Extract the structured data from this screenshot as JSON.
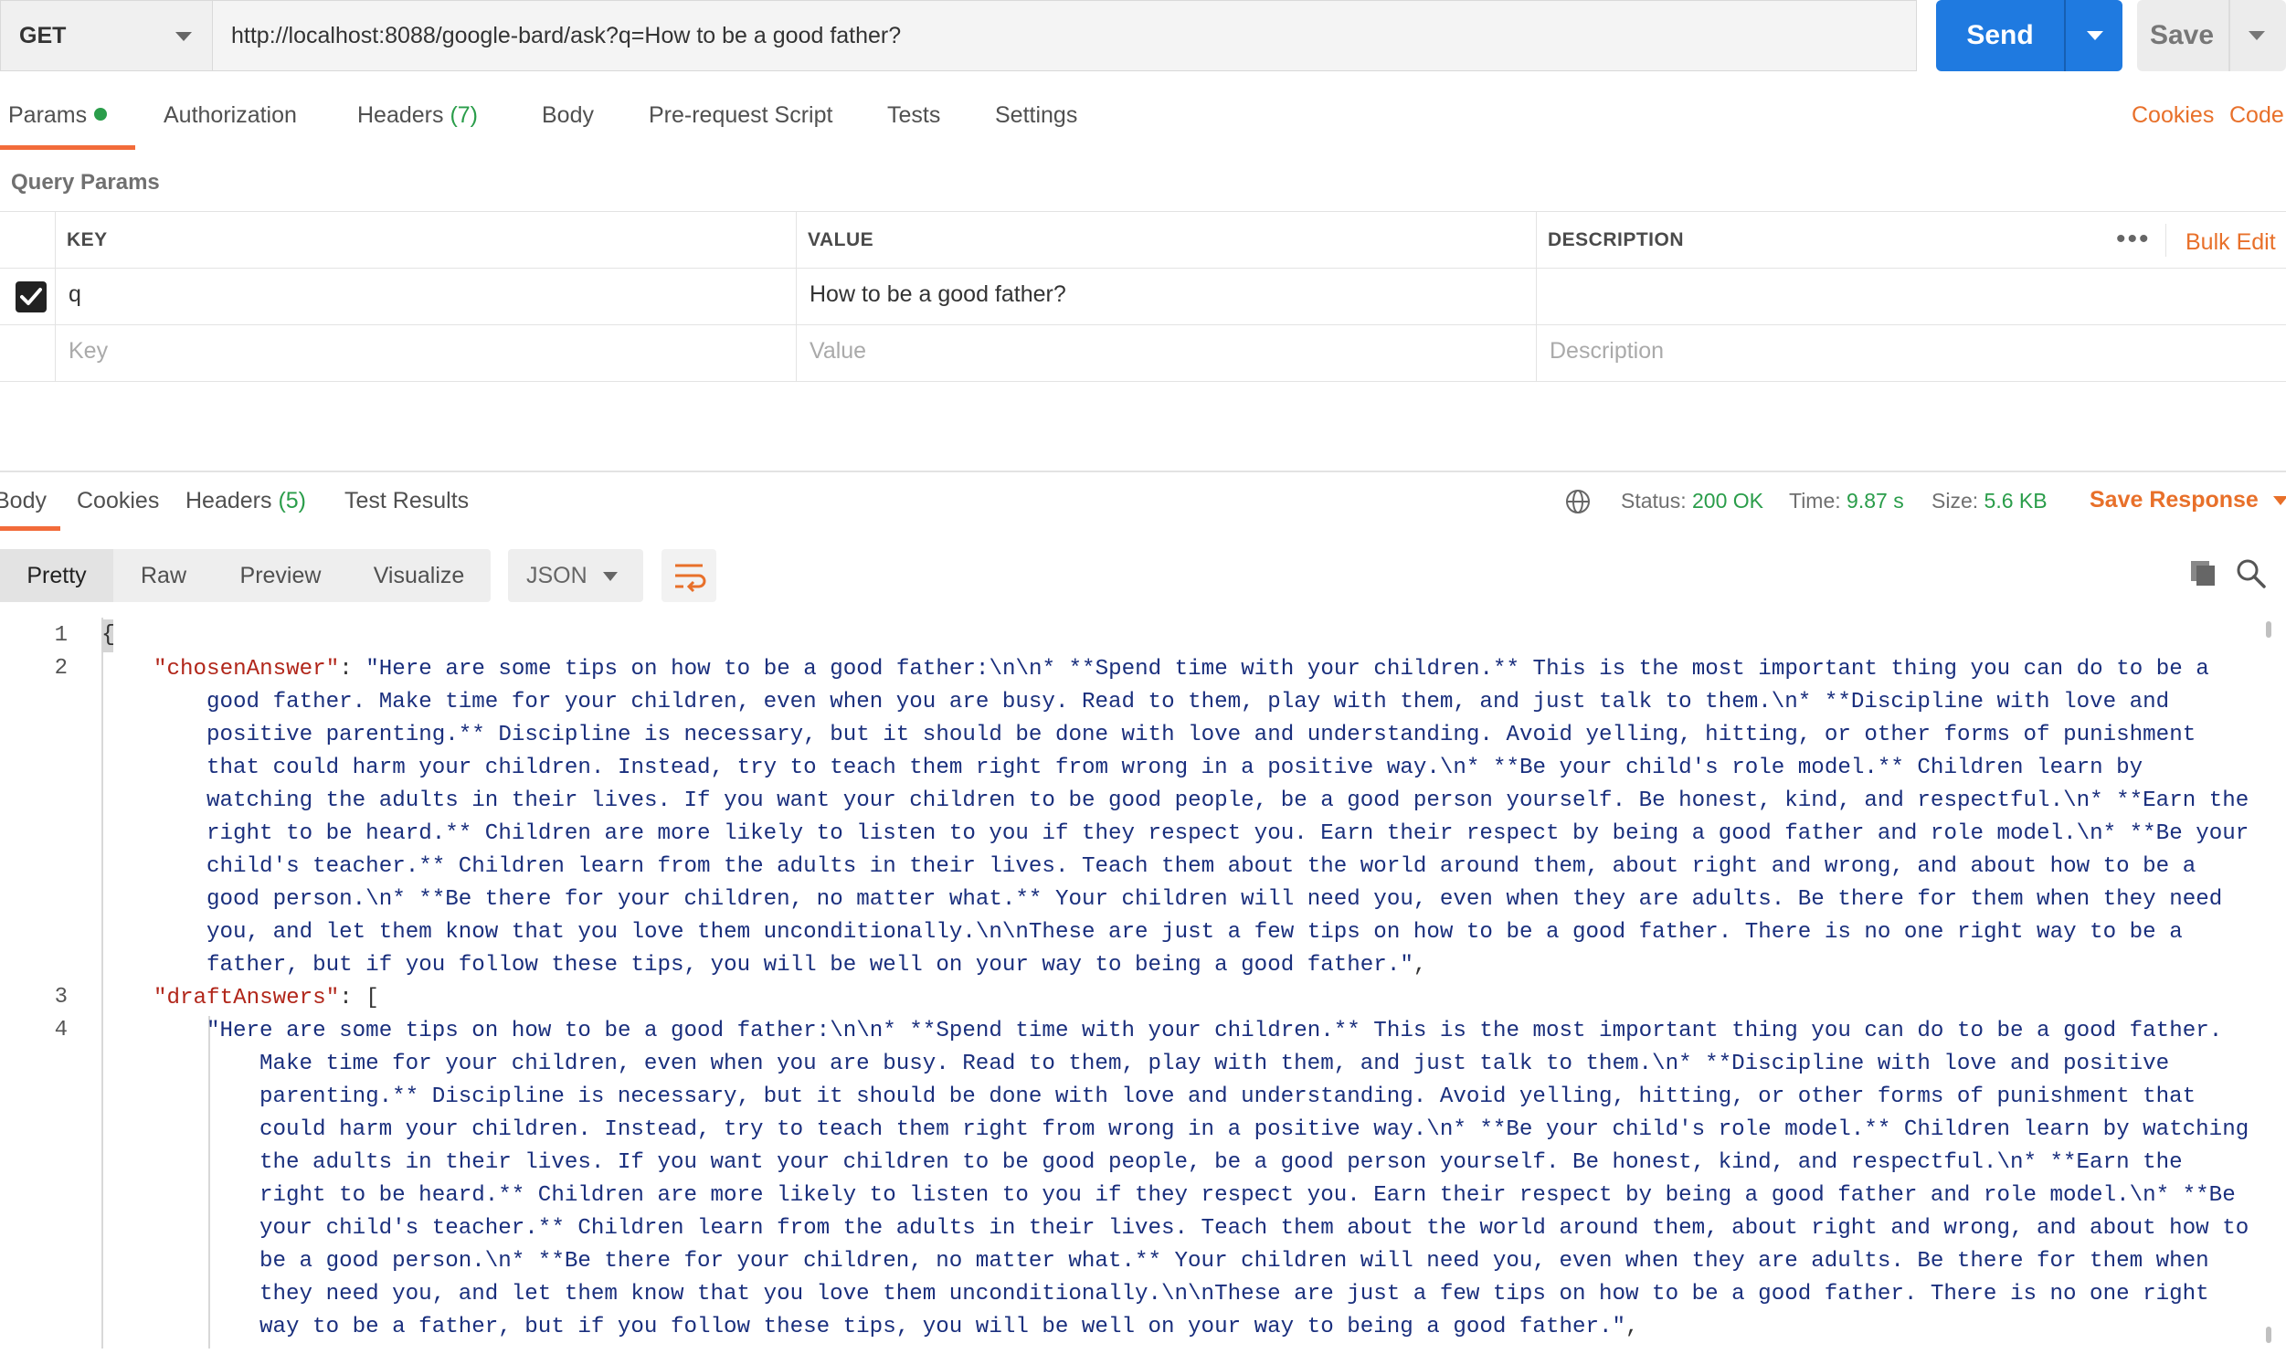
{
  "request": {
    "method": "GET",
    "url": "http://localhost:8088/google-bard/ask?q=How to be a good father?",
    "send_label": "Send",
    "save_label": "Save"
  },
  "request_tabs": [
    {
      "label": "Params",
      "active": true
    },
    {
      "label": "Authorization"
    },
    {
      "label": "Headers",
      "count": "(7)"
    },
    {
      "label": "Body"
    },
    {
      "label": "Pre-request Script"
    },
    {
      "label": "Tests"
    },
    {
      "label": "Settings"
    }
  ],
  "right_links": {
    "cookies": "Cookies",
    "code": "Code"
  },
  "query_params": {
    "section_label": "Query Params",
    "headers": {
      "key": "KEY",
      "value": "VALUE",
      "description": "DESCRIPTION"
    },
    "bulk_edit": "Bulk Edit",
    "more": "•••",
    "rows": [
      {
        "checked": true,
        "key": "q",
        "value": "How to be a good father?",
        "description": ""
      }
    ],
    "placeholders": {
      "key": "Key",
      "value": "Value",
      "description": "Description"
    }
  },
  "response_tabs": [
    {
      "label": "Body",
      "active": true
    },
    {
      "label": "Cookies"
    },
    {
      "label": "Headers",
      "count": "(5)"
    },
    {
      "label": "Test Results"
    }
  ],
  "response_meta": {
    "status_label": "Status:",
    "status": "200 OK",
    "time_label": "Time:",
    "time": "9.87 s",
    "size_label": "Size:",
    "size": "5.6 KB",
    "save_response": "Save Response"
  },
  "view_modes": [
    "Pretty",
    "Raw",
    "Preview",
    "Visualize"
  ],
  "format": "JSON",
  "code": {
    "line_numbers": [
      "1",
      "2",
      "3",
      "4"
    ],
    "open_brace": "{",
    "chosen_key": "\"chosenAnswer\"",
    "chosen_value": "\"Here are some tips on how to be a good father:\\n\\n* **Spend time with your children.** This is the most important thing you can do to be a good father. Make time for your children, even when you are busy. Read to them, play with them, and just talk to them.\\n* **Discipline with love and positive parenting.** Discipline is necessary, but it should be done with love and understanding. Avoid yelling, hitting, or other forms of punishment that could harm your children. Instead, try to teach them right from wrong in a positive way.\\n* **Be your child's role model.** Children learn by watching the adults in their lives. If you want your children to be good people, be a good person yourself. Be honest, kind, and respectful.\\n* **Earn the right to be heard.** Children are more likely to listen to you if they respect you. Earn their respect by being a good father and role model.\\n* **Be your child's teacher.** Children learn from the adults in their lives. Teach them about the world around them, about right and wrong, and about how to be a good person.\\n* **Be there for your children, no matter what.** Your children will need you, even when they are adults. Be there for them when they need you, and let them know that you love them unconditionally.\\n\\nThese are just a few tips on how to be a good father. There is no one right way to be a father, but if you follow these tips, you will be well on your way to being a good father.\"",
    "draft_key": "\"draftAnswers\"",
    "draft_first": "\"Here are some tips on how to be a good father:\\n\\n* **Spend time with your children.** This is the most important thing you can do to be a good father. Make time for your children, even when you are busy. Read to them, play with them, and just talk to them.\\n* **Discipline with love and positive parenting.** Discipline is necessary, but it should be done with love and understanding. Avoid yelling, hitting, or other forms of punishment that could harm your children. Instead, try to teach them right from wrong in a positive way.\\n* **Be your child's role model.** Children learn by watching the adults in their lives. If you want your children to be good people, be a good person yourself. Be honest, kind, and respectful.\\n* **Earn the right to be heard.** Children are more likely to listen to you if they respect you. Earn their respect by being a good father and role model.\\n* **Be your child's teacher.** Children learn from the adults in their lives. Teach them about the world around them, about right and wrong, and about how to be a good person.\\n* **Be there for your children, no matter what.** Your children will need you, even when they are adults. Be there for them when they need you, and let them know that you love them unconditionally.\\n\\nThese are just a few tips on how to be a good father. There is no one right way to be a father, but if you follow these tips, you will be well on your way to being a good father.\""
  },
  "colors": {
    "accent": "#f26b3a",
    "send": "#1f7ae0",
    "success": "#2a9d4a",
    "link": "#e8702a"
  },
  "icons": [
    "chevron-down-icon",
    "check-icon",
    "globe-icon",
    "wrap-lines-icon",
    "copy-icon",
    "search-icon"
  ]
}
